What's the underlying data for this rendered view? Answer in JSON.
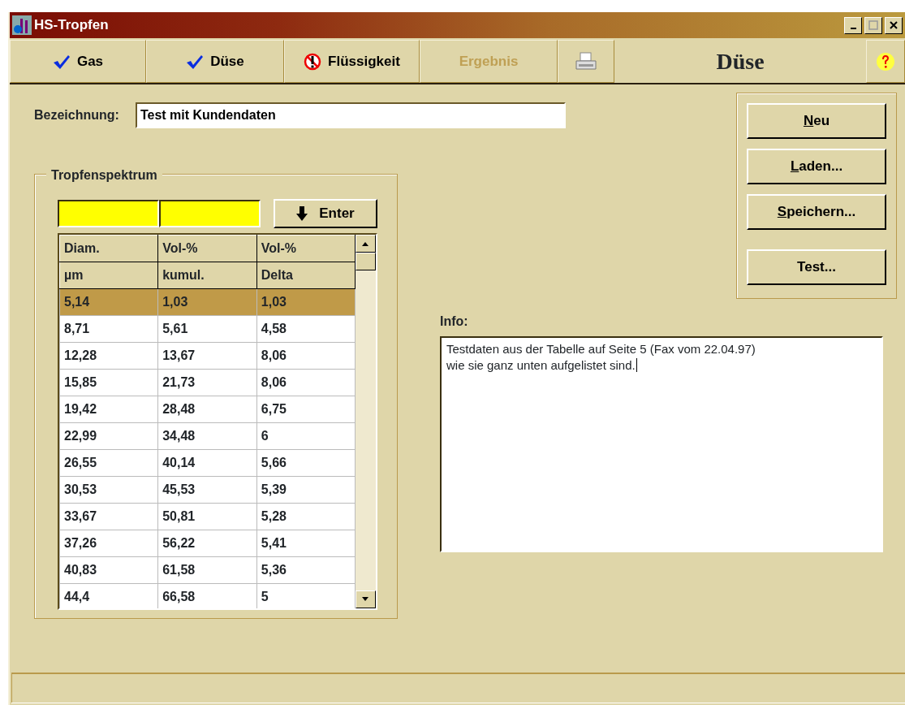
{
  "window": {
    "title": "HS-Tropfen"
  },
  "tabs": [
    {
      "kind": "check",
      "label": "Gas",
      "disabled": false
    },
    {
      "kind": "check",
      "label": "Düse",
      "disabled": false
    },
    {
      "kind": "warning",
      "label": "Flüssigkeit",
      "disabled": false
    },
    {
      "kind": "plain",
      "label": "Ergebnis",
      "disabled": true
    },
    {
      "kind": "print",
      "disabled": false
    }
  ],
  "page_title": "Düse",
  "bezeichnung": {
    "label": "Bezeichnung:",
    "value": "Test mit Kundendaten"
  },
  "spectrum": {
    "title": "Tropfenspektrum",
    "enter_button": "Enter",
    "header_rows": [
      [
        "Diam.",
        "Vol-%",
        "Vol-%"
      ],
      [
        "µm",
        "kumul.",
        "Delta"
      ]
    ],
    "rows": [
      {
        "cells": [
          "5,14",
          "1,03",
          "1,03"
        ],
        "selected": true
      },
      {
        "cells": [
          "8,71",
          "5,61",
          "4,58"
        ],
        "selected": false
      },
      {
        "cells": [
          "12,28",
          "13,67",
          "8,06"
        ],
        "selected": false
      },
      {
        "cells": [
          "15,85",
          "21,73",
          "8,06"
        ],
        "selected": false
      },
      {
        "cells": [
          "19,42",
          "28,48",
          "6,75"
        ],
        "selected": false
      },
      {
        "cells": [
          "22,99",
          "34,48",
          "6"
        ],
        "selected": false
      },
      {
        "cells": [
          "26,55",
          "40,14",
          "5,66"
        ],
        "selected": false
      },
      {
        "cells": [
          "30,53",
          "45,53",
          "5,39"
        ],
        "selected": false
      },
      {
        "cells": [
          "33,67",
          "50,81",
          "5,28"
        ],
        "selected": false
      },
      {
        "cells": [
          "37,26",
          "56,22",
          "5,41"
        ],
        "selected": false
      },
      {
        "cells": [
          "40,83",
          "61,58",
          "5,36"
        ],
        "selected": false
      },
      {
        "cells": [
          "44,4",
          "66,58",
          "5"
        ],
        "selected": false
      }
    ]
  },
  "info": {
    "label": "Info:",
    "lines": [
      "Testdaten aus der Tabelle auf Seite 5 (Fax vom 22.04.97)",
      "wie sie ganz unten aufgelistet sind."
    ]
  },
  "buttons": [
    {
      "label": "Neu",
      "hotkey_first": true
    },
    {
      "label": "Laden...",
      "hotkey_first": true
    },
    {
      "label": "Speichern...",
      "hotkey_first": true
    },
    {
      "label": "Test...",
      "hotkey_first": false
    }
  ]
}
